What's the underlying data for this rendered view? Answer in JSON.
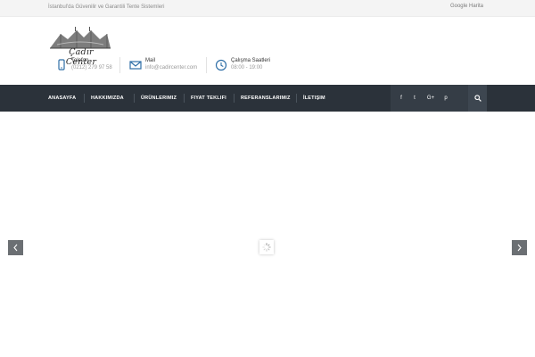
{
  "topbar": {
    "tagline": "İstanbul'da Güvenilir ve Garantili Tente Sistemleri",
    "map_link": "Google Harita"
  },
  "header": {
    "logo_text": "Çadır Center",
    "info": [
      {
        "icon": "phone-icon",
        "label": "Telefon",
        "value": "(0212) 279 97 58"
      },
      {
        "icon": "mail-icon",
        "label": "Mail",
        "value": "info@cadircenter.com"
      },
      {
        "icon": "clock-icon",
        "label": "Çalışma Saatleri",
        "value": "08:00 - 19:00"
      }
    ]
  },
  "nav": {
    "items": [
      "ANASAYFA",
      "HAKKIMIZDA",
      "ÜRÜNLERIMIZ",
      "FIYAT TEKLIFI",
      "REFERANSLARIMIZ",
      "İLETIŞIM"
    ],
    "social": [
      {
        "icon": "facebook-icon",
        "glyph": "f"
      },
      {
        "icon": "twitter-icon",
        "glyph": "t"
      },
      {
        "icon": "google-plus-icon",
        "glyph": "G+"
      },
      {
        "icon": "pinterest-icon",
        "glyph": "p"
      }
    ]
  },
  "colors": {
    "nav_bg": "#2b323a",
    "accent_icon": "#2f6fa7",
    "topbar_bg": "#f4f4f4"
  }
}
